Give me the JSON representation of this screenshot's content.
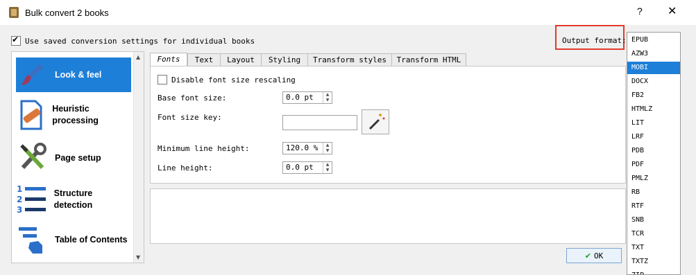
{
  "window": {
    "title": "Bulk convert 2 books",
    "help": "?",
    "close": "✕"
  },
  "use_saved": {
    "label": "Use saved conversion settings for individual books",
    "checked": true
  },
  "output_format": {
    "label": "Output format:",
    "options": [
      "EPUB",
      "AZW3",
      "MOBI",
      "DOCX",
      "FB2",
      "HTMLZ",
      "LIT",
      "LRF",
      "PDB",
      "PDF",
      "PMLZ",
      "RB",
      "RTF",
      "SNB",
      "TCR",
      "TXT",
      "TXTZ",
      "ZIP"
    ],
    "selected": "MOBI"
  },
  "sidebar": {
    "items": [
      {
        "label": "Look & feel",
        "icon": "paintbrush-icon",
        "selected": true
      },
      {
        "label": "Heuristic processing",
        "icon": "bandaged-document-icon"
      },
      {
        "label": "Page setup",
        "icon": "tools-icon"
      },
      {
        "label": "Structure detection",
        "icon": "numbered-list-icon"
      },
      {
        "label": "Table of Contents",
        "icon": "toc-hand-icon"
      }
    ]
  },
  "tabs": [
    "Fonts",
    "Text",
    "Layout",
    "Styling",
    "Transform styles",
    "Transform HTML"
  ],
  "fonts": {
    "disable_rescaling": "Disable font size rescaling",
    "base_font_size_label": "Base font size:",
    "base_font_size_value": "0.0 pt",
    "font_size_key_label": "Font size key:",
    "font_size_key_value": "",
    "min_line_height_label": "Minimum line height:",
    "min_line_height_value": "120.0 %",
    "line_height_label": "Line height:",
    "line_height_value": "0.0 pt"
  },
  "ok_button": "OK",
  "colors": {
    "accent": "#1e7fd8",
    "highlight_border": "#e23a2b"
  }
}
